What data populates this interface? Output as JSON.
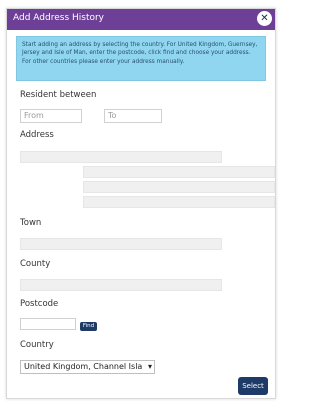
{
  "dialog": {
    "title": "Add Address History",
    "close_icon": "close-icon",
    "info_text": "Start adding an address by selecting the country. For United Kingdom, Guernsey, Jersey and Isle of Man, enter the postcode, click find and choose your address. For other countries please enter your address manually.",
    "resident_between_label": "Resident between",
    "from_placeholder": "From",
    "to_placeholder": "To",
    "address_label": "Address",
    "town_label": "Town",
    "county_label": "County",
    "postcode_label": "Postcode",
    "find_button": "Find",
    "country_label": "Country",
    "country_selected": "United Kingdom, Channel Isla",
    "select_button": "Select"
  },
  "colors": {
    "titlebar": "#6d3f96",
    "info_bg": "#91d6f0",
    "button": "#1e3a67"
  }
}
